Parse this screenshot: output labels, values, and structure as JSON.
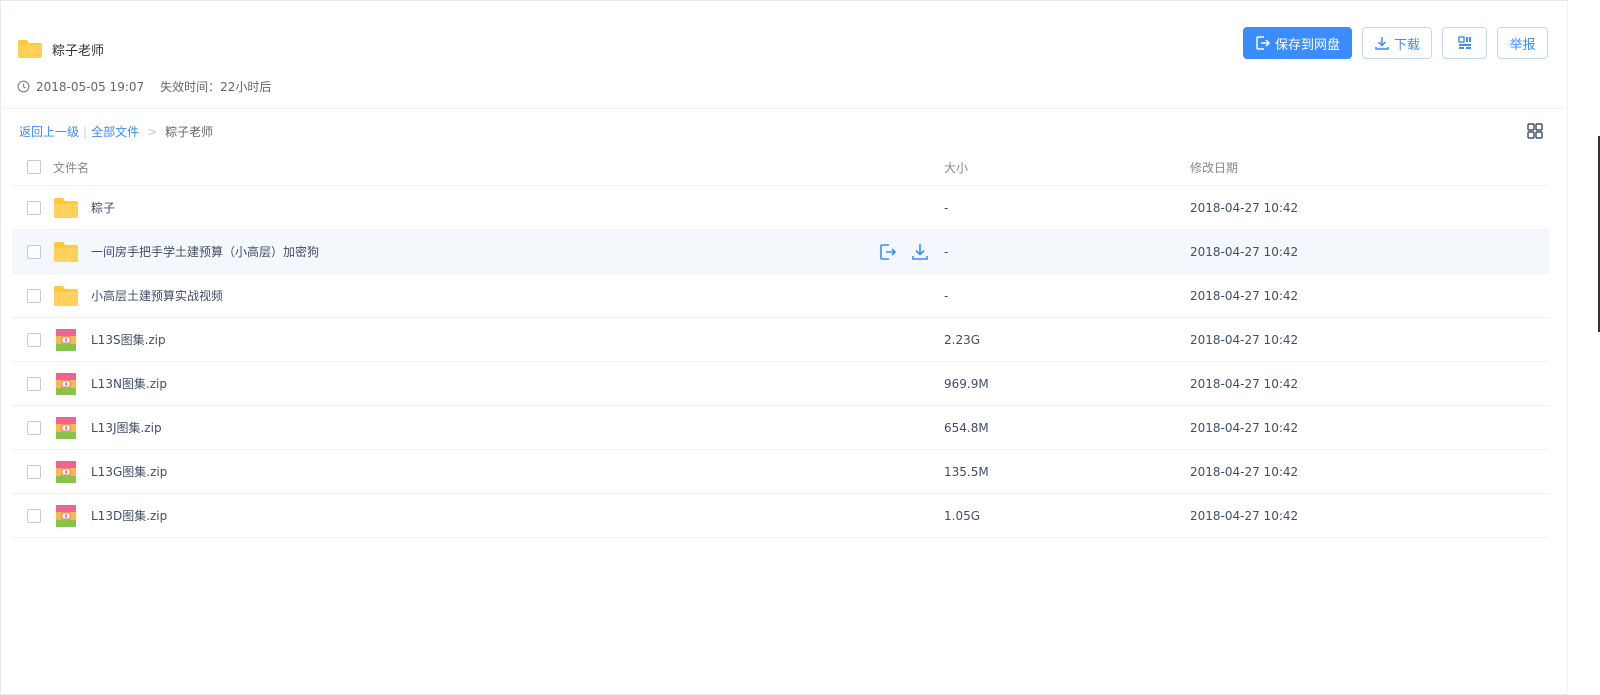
{
  "share": {
    "title": "粽子老师",
    "created": "2018-05-05 19:07",
    "expire": "失效时间：22小时后"
  },
  "actions": {
    "save_label": "保存到网盘",
    "download_label": "下载",
    "report_label": "举报"
  },
  "breadcrumb": {
    "back": "返回上一级",
    "sep": "|",
    "all_files": "全部文件",
    "gt": ">",
    "current": "粽子老师"
  },
  "columns": {
    "name": "文件名",
    "size": "大小",
    "date": "修改日期"
  },
  "files": [
    {
      "name": "粽子",
      "size": "-",
      "date": "2018-04-27 10:42"
    },
    {
      "name": "一间房手把手学土建预算（小高层）加密狗",
      "size": "-",
      "date": "2018-04-27 10:42"
    },
    {
      "name": "小高层土建预算实战视频",
      "size": "-",
      "date": "2018-04-27 10:42"
    },
    {
      "name": "L13S图集.zip",
      "size": "2.23G",
      "date": "2018-04-27 10:42"
    },
    {
      "name": "L13N图集.zip",
      "size": "969.9M",
      "date": "2018-04-27 10:42"
    },
    {
      "name": "L13J图集.zip",
      "size": "654.8M",
      "date": "2018-04-27 10:42"
    },
    {
      "name": "L13G图集.zip",
      "size": "135.5M",
      "date": "2018-04-27 10:42"
    },
    {
      "name": "L13D图集.zip",
      "size": "1.05G",
      "date": "2018-04-27 10:42"
    }
  ],
  "colors": {
    "accent": "#3b8cff",
    "folder": "#ffc93c",
    "hover_row": "#f4f8fd"
  }
}
